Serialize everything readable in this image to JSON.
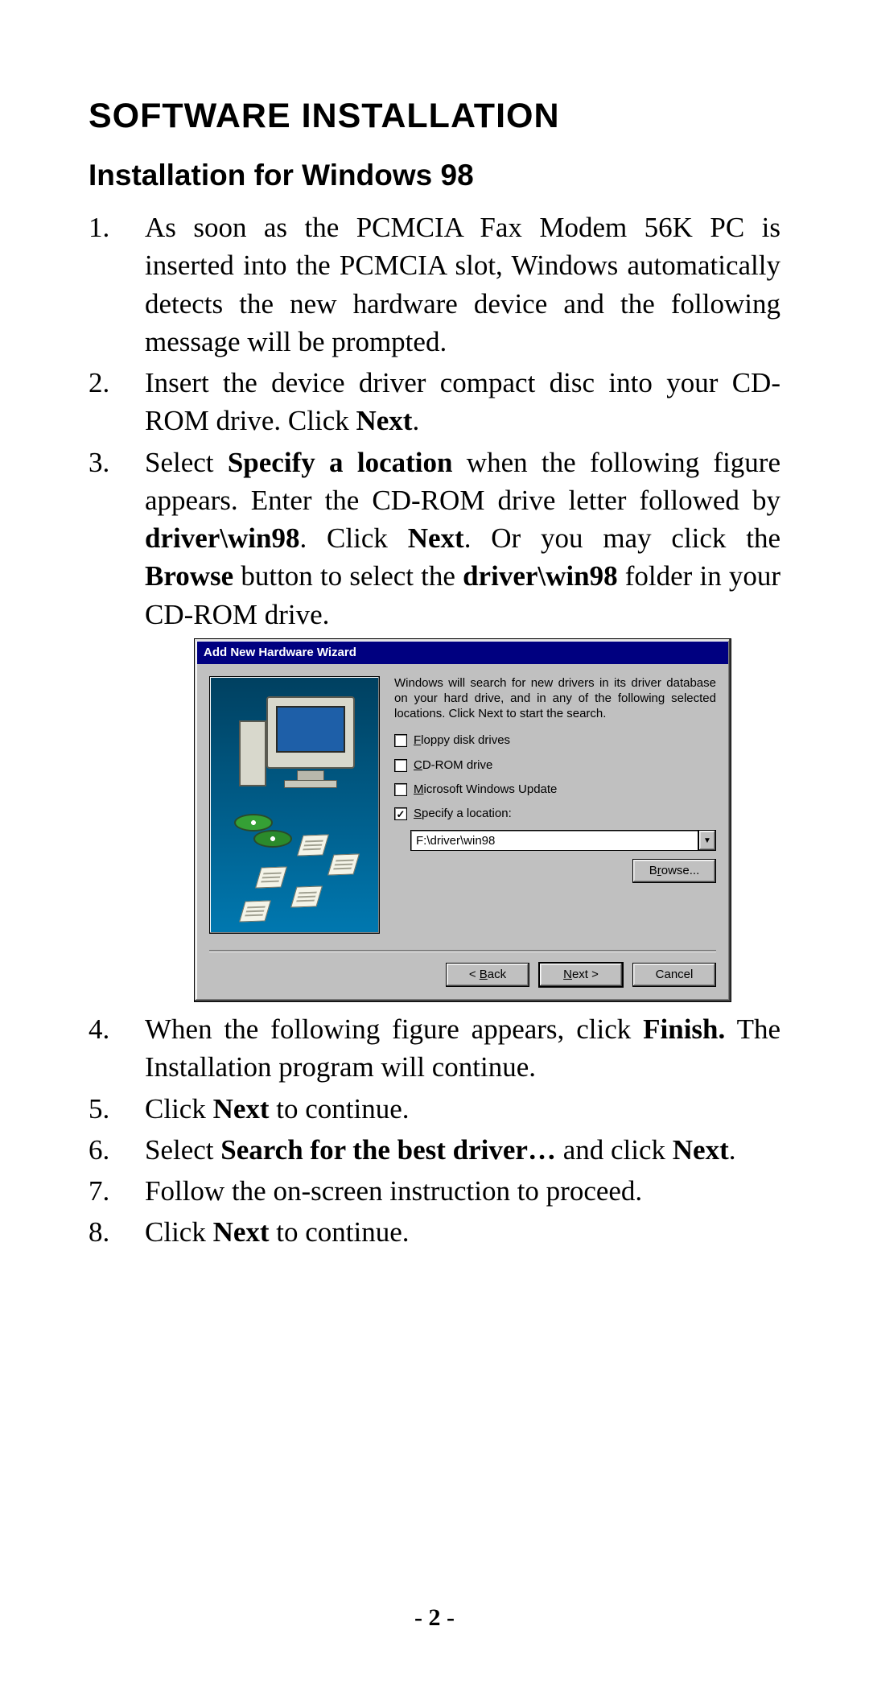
{
  "title": "SOFTWARE INSTALLATION",
  "subtitle": "Installation for Windows 98",
  "steps": {
    "s1": "As soon as the PCMCIA Fax Modem 56K PC is inserted into the PCMCIA slot, Windows automatically detects the new hardware device and the following message will be prompted.",
    "s2_a": "Insert the device driver compact disc into your CD-ROM drive. Click ",
    "s2_b": "Next",
    "s2_c": ".",
    "s3_a": "Select ",
    "s3_b": "Specify a location",
    "s3_c": " when the following figure appears. Enter the CD-ROM drive letter followed by ",
    "s3_d": "driver\\win98",
    "s3_e": ". Click ",
    "s3_f": "Next",
    "s3_g": ". Or you may click the ",
    "s3_h": "Browse",
    "s3_i": " button to select the ",
    "s3_j": "driver\\win98",
    "s3_k": " folder in your CD-ROM drive.",
    "s4_a": "When the following figure appears, click ",
    "s4_b": "Finish.",
    "s4_c": " The Installation program will continue.",
    "s5_a": "Click ",
    "s5_b": "Next",
    "s5_c": " to continue.",
    "s6_a": "Select ",
    "s6_b": "Search for the best driver…",
    "s6_c": " and click ",
    "s6_d": "Next",
    "s6_e": ".",
    "s7": "Follow the on-screen instruction to proceed.",
    "s8_a": "Click ",
    "s8_b": "Next",
    "s8_c": " to continue."
  },
  "dialog": {
    "title": "Add New Hardware Wizard",
    "desc": "Windows will search for new drivers in its driver database on your hard drive, and in any of the following selected locations. Click Next to start the search.",
    "opt_floppy_pre": "F",
    "opt_floppy_rest": "loppy disk drives",
    "opt_cd_pre": "C",
    "opt_cd_rest": "D-ROM drive",
    "opt_mu_pre": "M",
    "opt_mu_rest": "icrosoft Windows Update",
    "opt_spec_pre": "S",
    "opt_spec_rest": "pecify a location:",
    "checkmark": "✓",
    "combo_value": "F:\\driver\\win98",
    "dropdown_glyph": "▼",
    "browse_pre": "B",
    "browse_u": "r",
    "browse_rest": "owse...",
    "back_lt": "< ",
    "back_u": "B",
    "back_rest": "ack",
    "next_u": "N",
    "next_rest": "ext >",
    "cancel": "Cancel"
  },
  "page_number": "- 2 -"
}
